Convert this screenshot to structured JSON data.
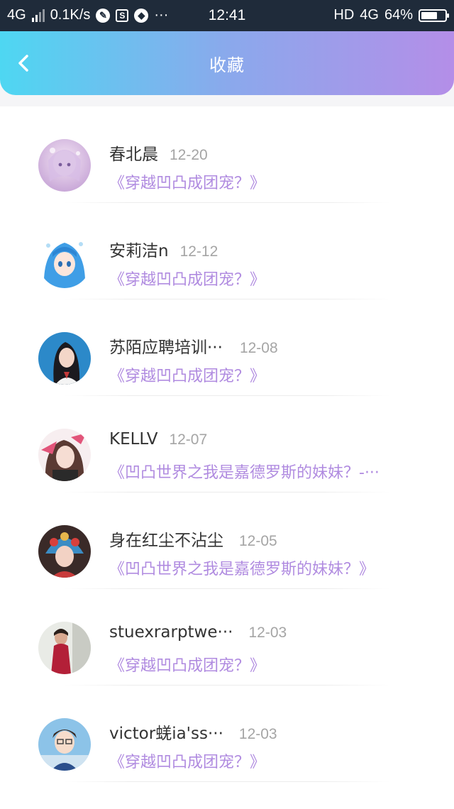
{
  "status_bar": {
    "network": "4G",
    "speed": "0.1K/s",
    "more": "···",
    "time": "12:41",
    "hd": "HD",
    "net_type": "4G",
    "battery": "64%"
  },
  "header": {
    "title": "收藏",
    "back_icon": "chevron-left-icon"
  },
  "items": [
    {
      "name": "春北晨",
      "date": "12-20",
      "book": "《穿越凹凸成团宠？》"
    },
    {
      "name": "安莉洁n",
      "date": "12-12",
      "book": "《穿越凹凸成团宠？》"
    },
    {
      "name": "苏陌应聘培训···",
      "date": "12-08",
      "book": "《穿越凹凸成团宠？》"
    },
    {
      "name": "KELLV",
      "date": "12-07",
      "book": "《凹凸世界之我是嘉德罗斯的妹妹？-···"
    },
    {
      "name": "身在红尘不沾尘",
      "date": "12-05",
      "book": "《凹凸世界之我是嘉德罗斯的妹妹？》"
    },
    {
      "name": "stuexrarptwe···",
      "date": "12-03",
      "book": "《穿越凹凸成团宠？》"
    },
    {
      "name": "victor蜣ia'ss···",
      "date": "12-03",
      "book": "《穿越凹凸成团宠？》"
    }
  ],
  "colors": {
    "header_gradient": [
      "#4ed7f2",
      "#8aa9ec",
      "#b48ee8"
    ],
    "book_title": "#b08be0",
    "name": "#333333",
    "date": "#a5a5a5"
  }
}
